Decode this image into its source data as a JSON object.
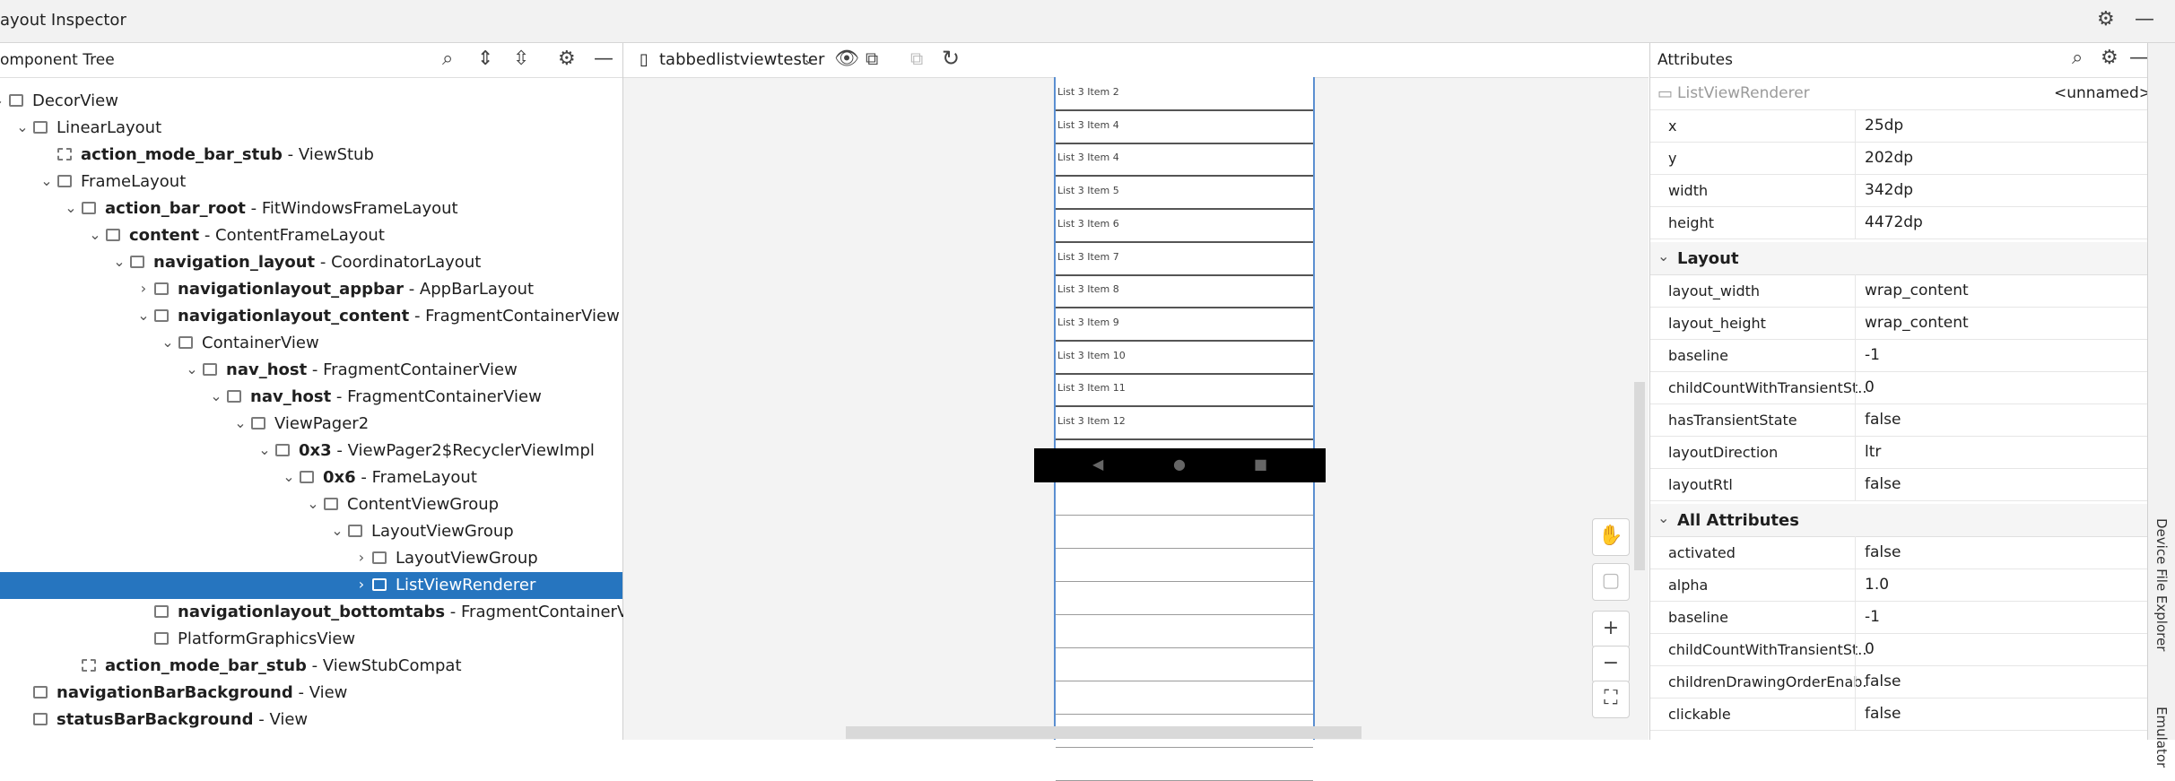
{
  "window": {
    "title": "ayout Inspector"
  },
  "tree": {
    "title": "omponent Tree",
    "rows": [
      {
        "name": "DecorView",
        "type": ""
      },
      {
        "name": "LinearLayout",
        "type": ""
      },
      {
        "name": "action_mode_bar_stub",
        "type": " - ViewStub"
      },
      {
        "name": "FrameLayout",
        "type": ""
      },
      {
        "name": "action_bar_root",
        "type": " - FitWindowsFrameLayout"
      },
      {
        "name": "content",
        "type": " - ContentFrameLayout"
      },
      {
        "name": "navigation_layout",
        "type": " - CoordinatorLayout"
      },
      {
        "name": "navigationlayout_appbar",
        "type": " - AppBarLayout"
      },
      {
        "name": "navigationlayout_content",
        "type": " - FragmentContainerView"
      },
      {
        "name": "ContainerView",
        "type": ""
      },
      {
        "name": "nav_host",
        "type": " - FragmentContainerView"
      },
      {
        "name": "nav_host",
        "type": " - FragmentContainerView"
      },
      {
        "name": "ViewPager2",
        "type": ""
      },
      {
        "name": "0x3",
        "type": " - ViewPager2$RecyclerViewImpl"
      },
      {
        "name": "0x6",
        "type": " - FrameLayout"
      },
      {
        "name": "ContentViewGroup",
        "type": ""
      },
      {
        "name": "LayoutViewGroup",
        "type": ""
      },
      {
        "name": "LayoutViewGroup",
        "type": ""
      },
      {
        "name": "ListViewRenderer",
        "type": ""
      },
      {
        "name": "navigationlayout_bottomtabs",
        "type": " - FragmentContainerView"
      },
      {
        "name": "PlatformGraphicsView",
        "type": ""
      },
      {
        "name": "action_mode_bar_stub",
        "type": " - ViewStubCompat"
      },
      {
        "name": "navigationBarBackground",
        "type": " - View"
      },
      {
        "name": "statusBarBackground",
        "type": " - View"
      }
    ]
  },
  "center": {
    "device": "tabbedlistviewtester",
    "list_items": [
      "List 3 Item 2",
      "List 3 Item 4",
      "List 3 Item 4",
      "List 3 Item 5",
      "List 3 Item 6",
      "List 3 Item 7",
      "List 3 Item 8",
      "List 3 Item 9",
      "List 3 Item 10",
      "List 3 Item 11",
      "List 3 Item 12"
    ]
  },
  "attributes": {
    "title": "Attributes",
    "selected_view": "ListViewRenderer",
    "selected_id": "<unnamed>",
    "basic": [
      {
        "key": "x",
        "value": "25dp"
      },
      {
        "key": "y",
        "value": "202dp"
      },
      {
        "key": "width",
        "value": "342dp"
      },
      {
        "key": "height",
        "value": "4472dp"
      }
    ],
    "layout_title": "Layout",
    "layout": [
      {
        "key": "layout_width",
        "value": "wrap_content"
      },
      {
        "key": "layout_height",
        "value": "wrap_content"
      },
      {
        "key": "baseline",
        "value": "-1"
      },
      {
        "key": "childCountWithTransientSt...",
        "value": "0"
      },
      {
        "key": "hasTransientState",
        "value": "false"
      },
      {
        "key": "layoutDirection",
        "value": "ltr"
      },
      {
        "key": "layoutRtl",
        "value": "false"
      }
    ],
    "all_title": "All Attributes",
    "all": [
      {
        "key": "activated",
        "value": "false"
      },
      {
        "key": "alpha",
        "value": "1.0"
      },
      {
        "key": "baseline",
        "value": "-1"
      },
      {
        "key": "childCountWithTransientSt...",
        "value": "0"
      },
      {
        "key": "childrenDrawingOrderEnab...",
        "value": "false"
      },
      {
        "key": "clickable",
        "value": "false"
      }
    ]
  },
  "right_strip": {
    "tab1": "Device File Explorer",
    "tab2": "Emulator"
  }
}
